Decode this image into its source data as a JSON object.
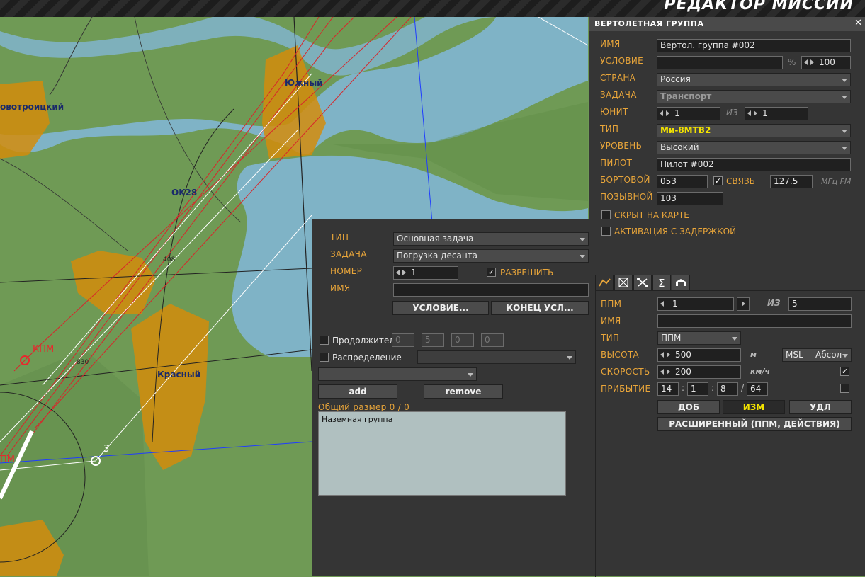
{
  "app": {
    "title": "РЕДАКТОР МИССИИ"
  },
  "map": {
    "labels": {
      "novotroitsky": "овотроицкий",
      "yuzhny": "Южный",
      "ok28": "OK28",
      "krasny": "Красный",
      "kpm": "КПМ",
      "ppm": "ПМ",
      "wp3": "3",
      "h408": "408",
      "h830": "830"
    }
  },
  "task_panel": {
    "type_label": "ТИП",
    "type_value": "Основная задача",
    "task_label": "ЗАДАЧА",
    "task_value": "Погрузка десанта",
    "number_label": "НОМЕР",
    "number_value": "1",
    "allow_label": "РАЗРЕШИТЬ",
    "allow_checked": true,
    "name_label": "ИМЯ",
    "name_value": "",
    "condition_button": "УСЛОВИЕ...",
    "end_condition_button": "КОНЕЦ УСЛ...",
    "duration_label": "Продолжитель",
    "duration_fields": [
      "0",
      "5",
      "0",
      "0"
    ],
    "distribution_label": "Распределение",
    "add_button": "add",
    "remove_button": "remove",
    "total_size": "Общий размер 0 / 0",
    "group_list": [
      "Наземная группа"
    ]
  },
  "group_panel": {
    "title": "ВЕРТОЛЕТНАЯ ГРУППА",
    "close": "✕",
    "name_label": "ИМЯ",
    "name_value": "Вертол. группа #002",
    "condition_label": "УСЛОВИЕ",
    "condition_value": "",
    "percent": "%",
    "probability": "100",
    "country_label": "СТРАНА",
    "country_value": "Россия",
    "task_label": "ЗАДАЧА",
    "task_value": "Транспорт",
    "unit_label": "ЮНИТ",
    "unit_value": "1",
    "of_label": "ИЗ",
    "unit_total": "1",
    "type_label": "ТИП",
    "type_value": "Ми-8МТВ2",
    "skill_label": "УРОВЕНЬ",
    "skill_value": "Высокий",
    "pilot_label": "ПИЛОТ",
    "pilot_value": "Пилот #002",
    "onboard_label": "БОРТОВОЙ",
    "onboard_value": "053",
    "comm_label": "СВЯЗЬ",
    "comm_checked": true,
    "frequency": "127.5",
    "freq_unit": "МГц FM",
    "callsign_label": "ПОЗЫВНОЙ",
    "callsign_value": "103",
    "hidden_label": "СКРЫТ НА КАРТЕ",
    "late_activation_label": "АКТИВАЦИЯ С ЗАДЕРЖКОЙ",
    "tabs": [
      "route-icon",
      "target-icon",
      "payload-icon",
      "sum-icon",
      "hangar-icon"
    ],
    "waypoint": {
      "ppm_label": "ППМ",
      "ppm_value": "1",
      "of_label": "ИЗ",
      "ppm_total": "5",
      "name_label": "ИМЯ",
      "name_value": "",
      "type_label": "ТИП",
      "type_value": "ППМ",
      "alt_label": "ВЫСОТА",
      "alt_value": "500",
      "alt_unit": "м",
      "alt_ref": "MSL",
      "alt_mode": "Абсол",
      "speed_label": "СКОРОСТЬ",
      "speed_value": "200",
      "speed_unit": "км/ч",
      "speed_checked": true,
      "arrival_label": "ПРИБЫТИЕ",
      "arrival_h": "14",
      "arrival_m": "1",
      "arrival_s": "8",
      "arrival_day": "64",
      "arrival_checked": false,
      "add_button": "ДОБ",
      "edit_button": "ИЗМ",
      "delete_button": "УДЛ",
      "advanced_button": "РАСШИРЕННЫЙ (ППМ, ДЕЙСТВИЯ)"
    }
  },
  "colors": {
    "accent": "#e8a53a",
    "panel": "#353535",
    "water": "#7fb3c6",
    "land": "#6f9a55",
    "town": "#d38c0c",
    "yellow": "#f2e200"
  }
}
